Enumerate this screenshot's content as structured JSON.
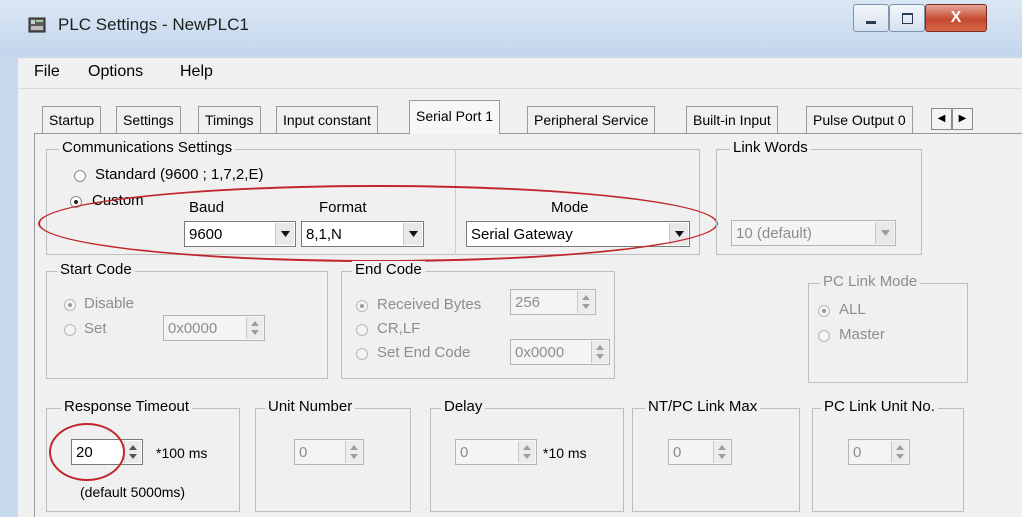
{
  "window": {
    "title": "PLC Settings - NewPLC1",
    "app_icon": "plc-icon",
    "controls": {
      "minimize": "–",
      "maximize": "□",
      "close": "X"
    }
  },
  "menu": [
    "File",
    "Options",
    "Help"
  ],
  "tabs": [
    {
      "label": "Startup",
      "active": false
    },
    {
      "label": "Settings",
      "active": false
    },
    {
      "label": "Timings",
      "active": false
    },
    {
      "label": "Input constant",
      "active": false
    },
    {
      "label": "Serial Port 1",
      "active": true
    },
    {
      "label": "Peripheral Service",
      "active": false
    },
    {
      "label": "Built-in Input",
      "active": false
    },
    {
      "label": "Pulse Output 0",
      "active": false
    }
  ],
  "tab_scroll": {
    "left": "◀",
    "right": "▶"
  },
  "communications": {
    "label": "Communications Settings",
    "standard": {
      "label": "Standard (9600 ; 1,7,2,E)",
      "checked": false
    },
    "custom": {
      "label": "Custom",
      "checked": true
    },
    "baud": {
      "label": "Baud",
      "value": "9600"
    },
    "format": {
      "label": "Format",
      "value": "8,1,N"
    },
    "mode": {
      "label": "Mode",
      "value": "Serial Gateway"
    }
  },
  "link_words": {
    "label": "Link Words",
    "value": "10 (default)"
  },
  "start_code": {
    "label": "Start Code",
    "disable": {
      "label": "Disable",
      "checked": true
    },
    "set": {
      "label": "Set",
      "checked": false
    },
    "value": "0x0000"
  },
  "end_code": {
    "label": "End Code",
    "received_bytes": {
      "label": "Received Bytes",
      "checked": true,
      "value": "256"
    },
    "crlf": {
      "label": "CR,LF",
      "checked": false
    },
    "set_end_code": {
      "label": "Set End Code",
      "checked": false,
      "value": "0x0000"
    }
  },
  "pc_link_mode": {
    "label": "PC Link Mode",
    "all": {
      "label": "ALL",
      "checked": true
    },
    "master": {
      "label": "Master",
      "checked": false
    }
  },
  "response_timeout": {
    "label": "Response Timeout",
    "value": "20",
    "unit": "*100 ms",
    "note": "(default 5000ms)"
  },
  "unit_number": {
    "label": "Unit Number",
    "value": "0"
  },
  "delay": {
    "label": "Delay",
    "value": "0",
    "unit": "*10 ms"
  },
  "nt_pc_link_max": {
    "label": "NT/PC Link Max",
    "value": "0"
  },
  "pc_link_unit_no": {
    "label": "PC Link Unit No.",
    "value": "0"
  },
  "colors": {
    "annotation": "#c0262c",
    "panel": "#f0f0f0",
    "titlebar": "#c9d9ec"
  }
}
